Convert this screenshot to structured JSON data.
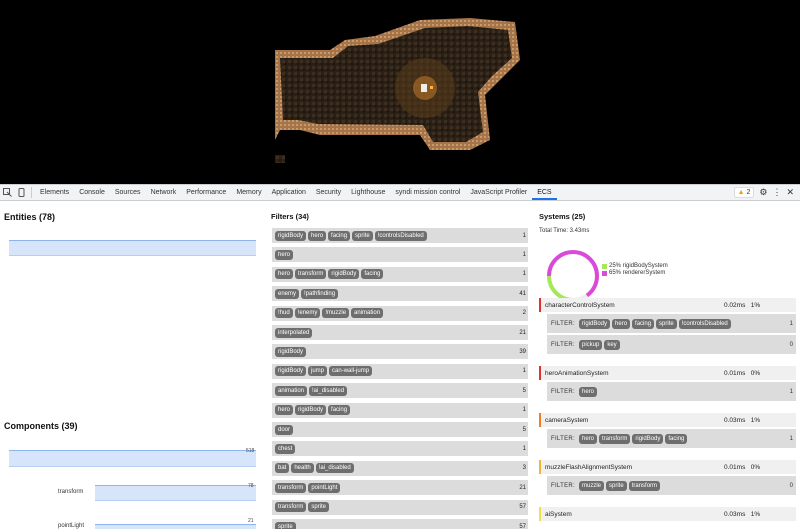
{
  "devtools": {
    "tabs": [
      "Elements",
      "Console",
      "Sources",
      "Network",
      "Performance",
      "Memory",
      "Application",
      "Security",
      "Lighthouse",
      "syndi mission control",
      "JavaScript Profiler",
      "ECS"
    ],
    "active_tab": "ECS",
    "warnings": "2",
    "icons": [
      "inspect-icon",
      "device-toolbar-icon",
      "warning-icon",
      "gear-icon",
      "more-icon",
      "close-icon"
    ]
  },
  "entities": {
    "title": "Entities (78)"
  },
  "components": {
    "title": "Components (39)",
    "rows": [
      {
        "label": "",
        "value": "518"
      },
      {
        "label": "transform",
        "value": "78"
      },
      {
        "label": "pointLight",
        "value": "21"
      }
    ]
  },
  "filters": {
    "title": "Filters (34)",
    "rows": [
      {
        "tags": [
          "rigidBody",
          "hero",
          "facing",
          "sprite",
          "!controlsDisabled"
        ],
        "count": "1"
      },
      {
        "tags": [
          "hero"
        ],
        "count": "1"
      },
      {
        "tags": [
          "hero",
          "transform",
          "rigidBody",
          "facing"
        ],
        "count": "1"
      },
      {
        "tags": [
          "enemy",
          "!pathfinding"
        ],
        "count": "41"
      },
      {
        "tags": [
          "!hud",
          "!enemy",
          "!muzzle",
          "animation"
        ],
        "count": "2"
      },
      {
        "tags": [
          "interpolated"
        ],
        "count": "21"
      },
      {
        "tags": [
          "rigidBody"
        ],
        "count": "39"
      },
      {
        "tags": [
          "rigidBody",
          "jump",
          "can-wall-jump"
        ],
        "count": "1"
      },
      {
        "tags": [
          "animation",
          "!ai_disabled"
        ],
        "count": "5"
      },
      {
        "tags": [
          "hero",
          "rigidBody",
          "facing"
        ],
        "count": "1"
      },
      {
        "tags": [
          "door"
        ],
        "count": "5"
      },
      {
        "tags": [
          "chest"
        ],
        "count": "1"
      },
      {
        "tags": [
          "bat",
          "health",
          "!ai_disabled"
        ],
        "count": "3"
      },
      {
        "tags": [
          "transform",
          "pointLight"
        ],
        "count": "21"
      },
      {
        "tags": [
          "transform",
          "sprite"
        ],
        "count": "57"
      },
      {
        "tags": [
          "sprite"
        ],
        "count": "57"
      }
    ]
  },
  "systems": {
    "title": "Systems (25)",
    "total_time": "Total Time: 3.43ms",
    "donut": {
      "rigidBodySystem": 25,
      "rendererSystem": 65
    },
    "legend": [
      "25% rigidBodySystem",
      "65% rendererSystem"
    ],
    "legend_colors": [
      "#a6e85a",
      "#d94ad9"
    ],
    "filter_label": "FILTER:",
    "list": [
      {
        "name": "characterControlSystem",
        "time": "0.02ms",
        "pct": "1%",
        "color": "#e0302f",
        "filters": [
          {
            "tags": [
              "rigidBody",
              "hero",
              "facing",
              "sprite",
              "!controlsDisabled"
            ],
            "count": "1"
          },
          {
            "tags": [
              "pickup",
              "key"
            ],
            "count": "0"
          }
        ]
      },
      {
        "name": "heroAnimationSystem",
        "time": "0.01ms",
        "pct": "0%",
        "color": "#e0302f",
        "filters": [
          {
            "tags": [
              "hero"
            ],
            "count": "1"
          }
        ]
      },
      {
        "name": "cameraSystem",
        "time": "0.03ms",
        "pct": "1%",
        "color": "#ef7d2a",
        "filters": [
          {
            "tags": [
              "hero",
              "transform",
              "rigidBody",
              "facing"
            ],
            "count": "1"
          }
        ]
      },
      {
        "name": "muzzleFlashAlignmentSystem",
        "time": "0.01ms",
        "pct": "0%",
        "color": "#f2b636",
        "filters": [
          {
            "tags": [
              "muzzle",
              "sprite",
              "transform"
            ],
            "count": "0"
          }
        ]
      },
      {
        "name": "aiSystem",
        "time": "0.03ms",
        "pct": "1%",
        "color": "#f2e04a",
        "filters": []
      }
    ]
  }
}
